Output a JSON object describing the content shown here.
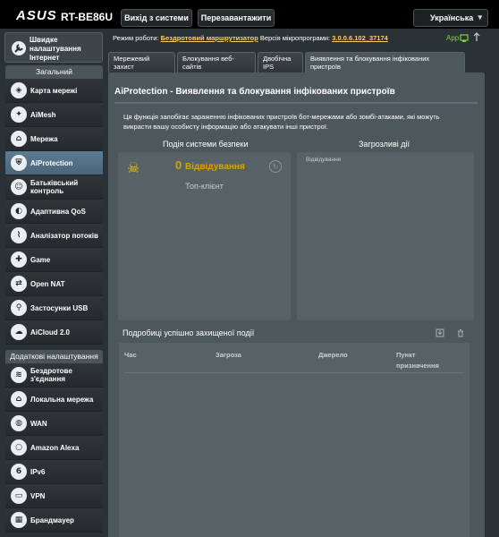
{
  "header": {
    "brand": "ASUS",
    "model": "RT-BE86U",
    "logout": "Вихід з системи",
    "reboot": "Перезавантажити",
    "language": "Українська"
  },
  "qis": {
    "label": "Швидке налаштування Інтернет",
    "icon": "wrench-icon"
  },
  "menu_general": {
    "title": "Загальний",
    "items": [
      {
        "label": "Карта мережі",
        "icon": "network-map-icon"
      },
      {
        "label": "AiMesh",
        "icon": "aimesh-icon"
      },
      {
        "label": "Мережа",
        "icon": "network-icon"
      },
      {
        "label": "AiProtection",
        "icon": "shield-icon"
      },
      {
        "label": "Батьківський контроль",
        "icon": "parental-control-icon"
      },
      {
        "label": "Адаптивна QoS",
        "icon": "qos-icon"
      },
      {
        "label": "Аналізатор потоків",
        "icon": "traffic-analyzer-icon"
      },
      {
        "label": "Game",
        "icon": "gamepad-icon"
      },
      {
        "label": "Open NAT",
        "icon": "open-nat-icon"
      },
      {
        "label": "Застосунки USB",
        "icon": "usb-icon"
      },
      {
        "label": "AiCloud 2.0",
        "icon": "cloud-icon"
      }
    ]
  },
  "menu_advanced": {
    "title": "Додаткові налаштування",
    "items": [
      {
        "label": "Бездротове з'єднання",
        "icon": "wireless-icon"
      },
      {
        "label": "Локальна мережа",
        "icon": "lan-icon"
      },
      {
        "label": "WAN",
        "icon": "globe-icon"
      },
      {
        "label": "Amazon Alexa",
        "icon": "alexa-icon"
      },
      {
        "label": "IPv6",
        "icon": "ipv6-icon"
      },
      {
        "label": "VPN",
        "icon": "vpn-icon"
      },
      {
        "label": "Брандмауер",
        "icon": "firewall-icon"
      }
    ]
  },
  "status": {
    "mode_label": "Режим роботи:",
    "mode_value": "Бездротовий маршрутизатор",
    "fw_label": "Версія мікропрограми:",
    "fw_value": "3.0.0.6.102_37174",
    "app_label": "App"
  },
  "tabs": [
    "Мережевий захист",
    "Блокування веб-сайтів",
    "Двобічна IPS",
    "Виявлення та блокування інфікованих пристроїв"
  ],
  "content": {
    "title": "AiProtection - Виявлення та блокування інфікованих пристроїв",
    "description": "Ця функція запобігає зараженню інфікованих пристроїв бот-мережами або зомбі-атаками, які можуть викрасти вашу особисту інформацію або атакувати інші пристрої.",
    "left_col_title": "Подія системи безпеки",
    "right_col_title": "Загрозливі дії",
    "count": "0",
    "visits_label": "Відвідування",
    "top_client": "Топ-клієнт",
    "right_panel_label": "Відвідування",
    "details_title": "Подробиці успішно захищеної події",
    "table_headers": [
      "Час",
      "Загроза",
      "Джерело",
      "Пункт призначення"
    ]
  },
  "colors": {
    "accent_selected": "#5d7b92",
    "warning_yellow": "#d9a400",
    "link_yellow": "#ffcc66",
    "app_green": "#7cd33a"
  }
}
